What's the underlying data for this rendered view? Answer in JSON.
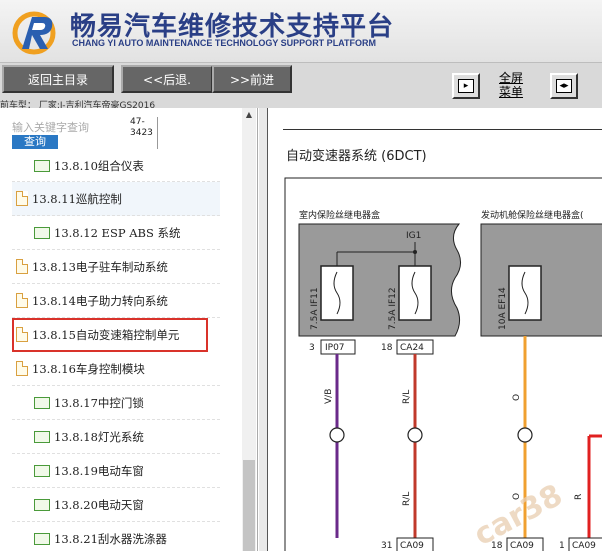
{
  "header": {
    "brand_title": "畅易汽车维修技术支持平台",
    "brand_subtitle": "CHANG YI AUTO MAINTENANCE TECHNOLOGY SUPPORT PLATFORM"
  },
  "toolbar": {
    "home_label": "返回主目录",
    "back_label": "<<后退.",
    "forward_label": ">>前进",
    "fullscreen_label_line1": "全屏",
    "fullscreen_label_line2": "菜单",
    "vehicle_info": "前车型： 厂家:J-吉利汽车帝豪GS2016"
  },
  "search": {
    "placeholder": "输入关键字查询",
    "button_label": "查询",
    "code_line1": "47-",
    "code_line2": "3423"
  },
  "tree": [
    {
      "label": "13.8.10组合仪表",
      "icon": "folder-icon"
    },
    {
      "label": "13.8.11巡航控制",
      "icon": "file-icon"
    },
    {
      "label": "13.8.12 ESP ABS 系统",
      "icon": "folder-icon"
    },
    {
      "label": "13.8.13电子驻车制动系统",
      "icon": "file-icon"
    },
    {
      "label": "13.8.14电子助力转向系统",
      "icon": "file-icon"
    },
    {
      "label": "13.8.15自动变速箱控制单元",
      "icon": "file-icon"
    },
    {
      "label": "13.8.16车身控制模块",
      "icon": "file-icon"
    },
    {
      "label": "13.8.17中控门锁",
      "icon": "folder-icon"
    },
    {
      "label": "13.8.18灯光系统",
      "icon": "folder-icon"
    },
    {
      "label": "13.8.19电动车窗",
      "icon": "folder-icon"
    },
    {
      "label": "13.8.20电动天窗",
      "icon": "folder-icon"
    },
    {
      "label": "13.8.21刮水器洗涤器",
      "icon": "folder-icon"
    }
  ],
  "document": {
    "title": "自动变速器系统 (6DCT)",
    "box1_label": "室内保险丝继电器盒",
    "box2_label": "发动机舱保险丝继电器盒(",
    "ig1": "IG1",
    "fuse1": "7.5A IF11",
    "fuse2": "7.5A IF12",
    "fuse3": "10A EF14",
    "pin1": "3",
    "conn1": "IP07",
    "pin2": "18",
    "conn2": "CA24",
    "wire1": "V/B",
    "wire2": "R/L",
    "wire3": "O",
    "wire4": "R",
    "pin3": "31",
    "conn3": "CA09",
    "pin4": "18",
    "conn4": "CA09",
    "pin5": "1",
    "conn5": "CA09",
    "watermark": "car38"
  },
  "colors": {
    "brand": "#2a3f86",
    "selection_border": "#d9322a",
    "wire_violet": "#6a2a8a",
    "wire_red": "#c0392b",
    "wire_orange": "#f0a030"
  }
}
